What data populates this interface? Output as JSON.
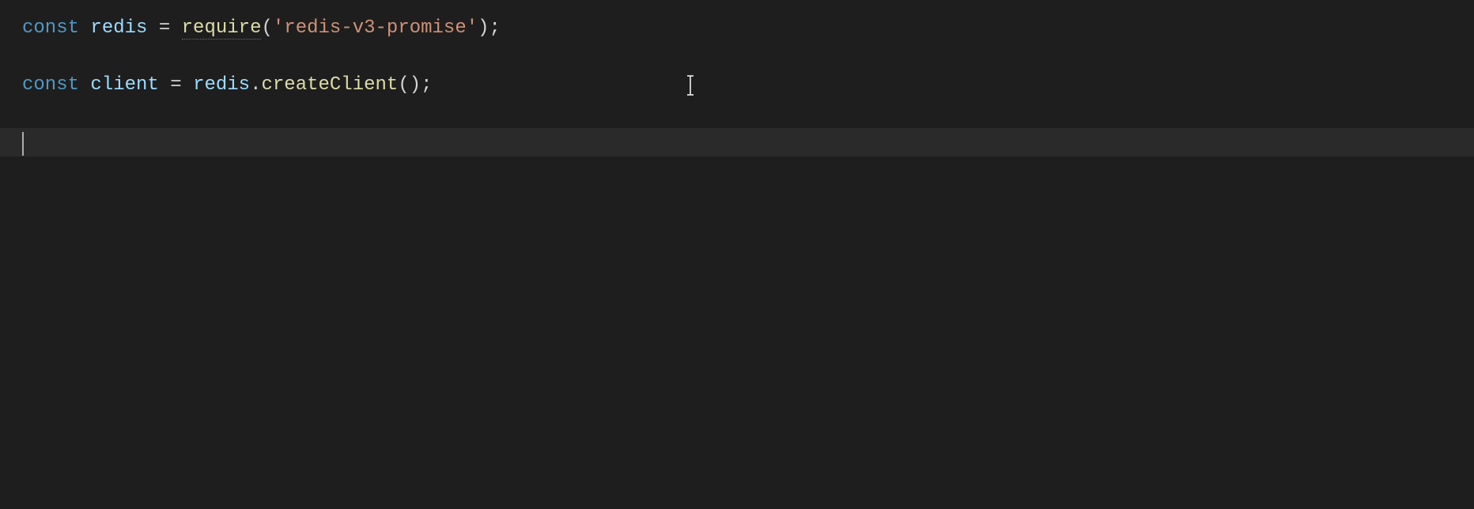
{
  "editor": {
    "line1": {
      "kw_const": "const",
      "sp": " ",
      "var_redis": "redis",
      "sp2": " ",
      "op_eq": "=",
      "sp3": " ",
      "fn_require": "require",
      "paren_open": "(",
      "str_module": "'redis-v3-promise'",
      "paren_close": ")",
      "semi": ";"
    },
    "line3": {
      "kw_const": "const",
      "sp": " ",
      "var_client": "client",
      "sp2": " ",
      "op_eq": "=",
      "sp3": " ",
      "prop_redis": "redis",
      "dot": ".",
      "fn_create": "createClient",
      "paren_open": "(",
      "paren_close": ")",
      "semi": ";"
    }
  }
}
